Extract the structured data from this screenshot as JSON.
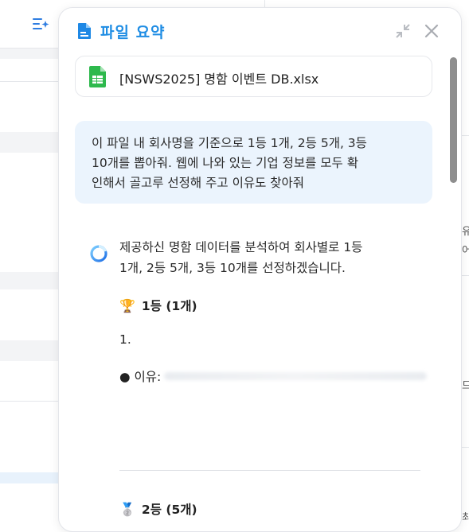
{
  "panel": {
    "title": "파일 요약",
    "file": {
      "name": "[NSWS2025] 명함 이벤트 DB.xlsx",
      "icon": "spreadsheet-icon"
    }
  },
  "prompt": {
    "lines": [
      "이 파일 내 회사명을 기준으로 1등 1개, 2등 5개, 3등",
      "10개를 뽑아줘. 웹에 나와 있는 기업 정보를 모두 확",
      "인해서 골고루 선정해 주고 이유도 찾아줘"
    ]
  },
  "answer": {
    "intro_lines": [
      "제공하신 명함 데이터를 분석하여 회사별로 1등",
      "1개, 2등 5개, 3등 10개를 선정하겠습니다."
    ],
    "rank1": {
      "medal": "🏆",
      "label": "1등 (1개)"
    },
    "item_number": "1.",
    "reason_label": "● 이유:",
    "rank2": {
      "medal": "🥈",
      "label": "2등 (5개)"
    }
  },
  "background": {
    "edge_texts": [
      "유",
      "어",
      "드",
      "최"
    ]
  },
  "colors": {
    "accent": "#1f8de4",
    "prompt_bg": "#ebf4fd",
    "spreadsheet_green": "#2eb94d"
  }
}
